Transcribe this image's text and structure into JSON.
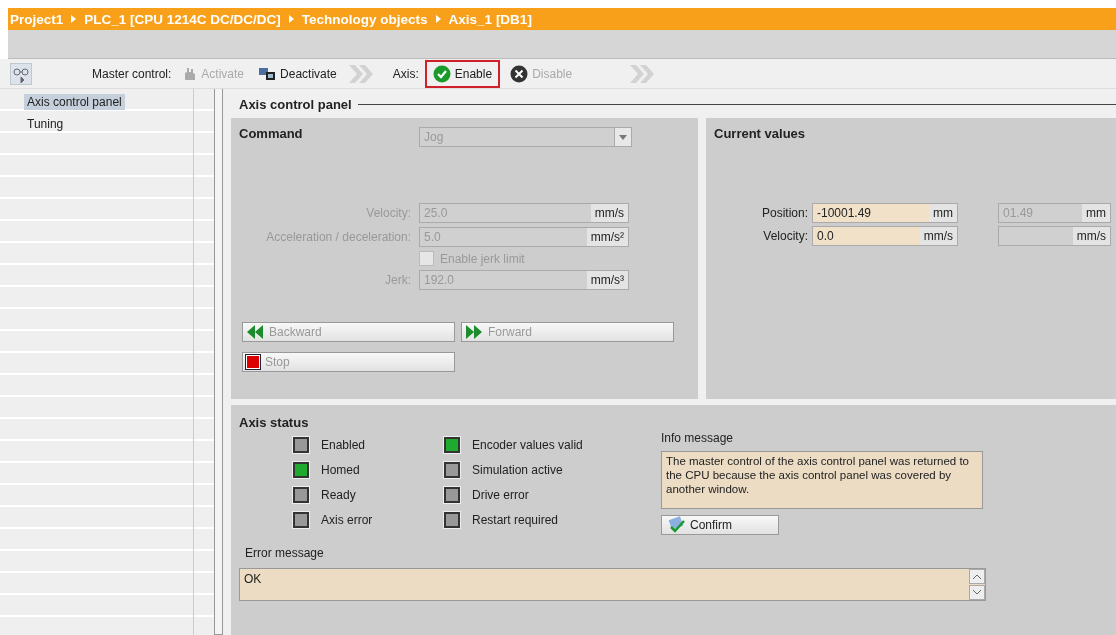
{
  "breadcrumb": [
    "Project1",
    "PLC_1 [CPU 1214C DC/DC/DC]",
    "Technology objects",
    "Axis_1 [DB1]"
  ],
  "toolbar": {
    "master_label": "Master control:",
    "activate": {
      "label": "Activate",
      "disabled": true
    },
    "deactivate": {
      "label": "Deactivate",
      "disabled": false
    },
    "axis_label": "Axis:",
    "enable": {
      "label": "Enable",
      "disabled": false,
      "highlighted": true
    },
    "disable": {
      "label": "Disable",
      "disabled": true
    }
  },
  "sidebar": {
    "items": [
      {
        "label": "Axis control panel",
        "selected": true
      },
      {
        "label": "Tuning",
        "selected": false
      }
    ]
  },
  "section_title": "Axis control panel",
  "command": {
    "title": "Command",
    "mode": {
      "value": "Jog",
      "disabled": true
    },
    "fields": [
      {
        "kind": "field",
        "label": "Velocity:",
        "value": "25.0",
        "unit": "mm/s",
        "disabled": true
      },
      {
        "kind": "field",
        "label": "Acceleration / deceleration:",
        "value": "5.0",
        "unit": "mm/s²",
        "disabled": true
      },
      {
        "kind": "checkbox",
        "label": "Enable jerk limit",
        "checked": false,
        "disabled": true
      },
      {
        "kind": "field",
        "label": "Jerk:",
        "value": "192.0",
        "unit": "mm/s³",
        "disabled": true
      }
    ],
    "buttons": [
      {
        "kind": "backward",
        "label": "Backward"
      },
      {
        "kind": "forward",
        "label": "Forward"
      },
      {
        "kind": "stop",
        "label": "Stop"
      }
    ]
  },
  "current_values": {
    "title": "Current values",
    "rows": [
      {
        "label": "Position:",
        "value": "-10001.49",
        "unit": "mm",
        "value_2": "01.49",
        "unit_2": "mm"
      },
      {
        "label": "Velocity:",
        "value": "0.0",
        "unit": "mm/s",
        "unit_2": "mm/s"
      }
    ]
  },
  "axis_status": {
    "title": "Axis status",
    "indicators": [
      {
        "label": "Enabled",
        "on": false
      },
      {
        "label": "Homed",
        "on": true
      },
      {
        "label": "Ready",
        "on": false
      },
      {
        "label": "Axis error",
        "on": false
      },
      {
        "label": "Encoder values valid",
        "on": true
      },
      {
        "label": "Simulation active",
        "on": false
      },
      {
        "label": "Drive error",
        "on": false
      },
      {
        "label": "Restart required",
        "on": false
      }
    ],
    "info_label": "Info message",
    "info_text": "The master control of the axis control panel was returned to the CPU because the axis control panel was covered by another window.",
    "confirm": "Confirm",
    "error_label": "Error message",
    "error_text": "OK"
  }
}
